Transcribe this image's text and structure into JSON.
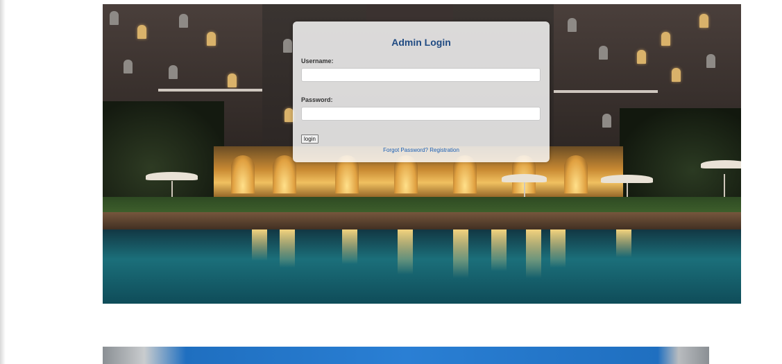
{
  "login": {
    "title": "Admin Login",
    "username_label": "Username:",
    "username_value": "",
    "password_label": "Password:",
    "password_value": "",
    "login_button": "login",
    "forgot_password_link": "Forgot Password?",
    "registration_link": "Registration"
  },
  "colors": {
    "title": "#1f4a82",
    "link": "#1a5fb4",
    "pool": "#1b6f7a"
  }
}
